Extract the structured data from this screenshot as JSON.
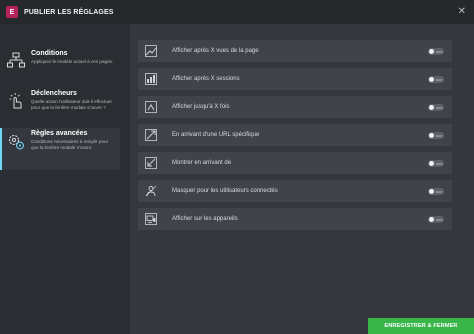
{
  "header": {
    "logo_text": "E",
    "title": "PUBLIER LES RÉGLAGES",
    "close_icon": "close-icon"
  },
  "sidebar": {
    "items": [
      {
        "title": "Conditions",
        "description": "Appliquez le modèle actuel à ces pages.",
        "icon": "sitemap-icon",
        "active": false
      },
      {
        "title": "Déclencheurs",
        "description": "Quelle action l'utilisateur doit-il effectuer pour que la fenêtre modale s'ouvre ?",
        "icon": "click-hand-icon",
        "active": false
      },
      {
        "title": "Règles avancées",
        "description": "Conditions nécessaires à remplir pour que la fenêtre modale s'ouvre.",
        "icon": "settings-gears-icon",
        "active": true
      }
    ]
  },
  "rules": {
    "toggle_off_text": "NON",
    "items": [
      {
        "label": "Afficher après X vues de la page",
        "icon": "page-views-icon",
        "enabled": false
      },
      {
        "label": "Afficher après X sessions",
        "icon": "sessions-icon",
        "enabled": false
      },
      {
        "label": "Afficher jusqu'à X fois",
        "icon": "times-icon",
        "enabled": false
      },
      {
        "label": "En arrivant d'une URL spécifique",
        "icon": "url-icon",
        "enabled": false
      },
      {
        "label": "Montrer en arrivant de",
        "icon": "arrival-icon",
        "enabled": false
      },
      {
        "label": "Masquer pour les utilisateurs connectés",
        "icon": "hide-users-icon",
        "enabled": false
      },
      {
        "label": "Afficher sur les appareils",
        "icon": "devices-icon",
        "enabled": false
      }
    ]
  },
  "footer": {
    "save_label": "ENREGISTRER & FERMER"
  },
  "colors": {
    "accent": "#71d7f7",
    "brand": "#b4235d",
    "save_button": "#39b54a"
  }
}
